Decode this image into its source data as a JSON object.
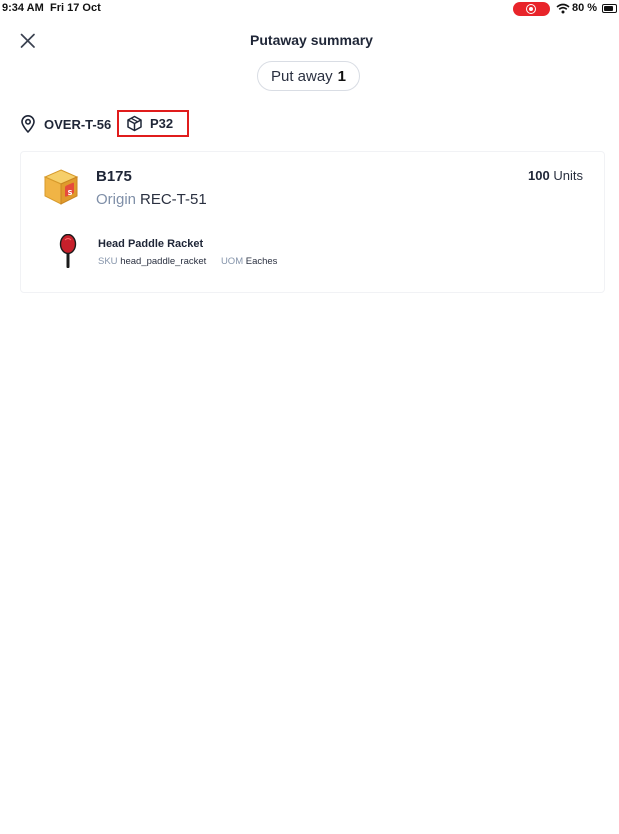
{
  "status_bar": {
    "time": "9:34 AM",
    "date": "Fri 17 Oct",
    "battery_percent": "80 %",
    "battery_level": 0.8,
    "recording_color": "#e8242a"
  },
  "header": {
    "title": "Putaway summary",
    "close_icon": "close-icon"
  },
  "putaway_chip": {
    "label": "Put away",
    "count": "1"
  },
  "location": {
    "icon": "map-pin-icon",
    "label": "OVER-T-56"
  },
  "pallet": {
    "icon": "cube-icon",
    "label": "P32",
    "highlight_color": "#e01c1c"
  },
  "batch": {
    "icon": "box-icon",
    "id": "B175",
    "origin_label": "Origin",
    "origin_value": "REC-T-51",
    "quantity": "100",
    "unit_label": "Units"
  },
  "product": {
    "icon": "paddle-racket-icon",
    "name": "Head Paddle Racket",
    "sku_label": "SKU",
    "sku_value": "head_paddle_racket",
    "uom_label": "UOM",
    "uom_value": "Eaches"
  }
}
